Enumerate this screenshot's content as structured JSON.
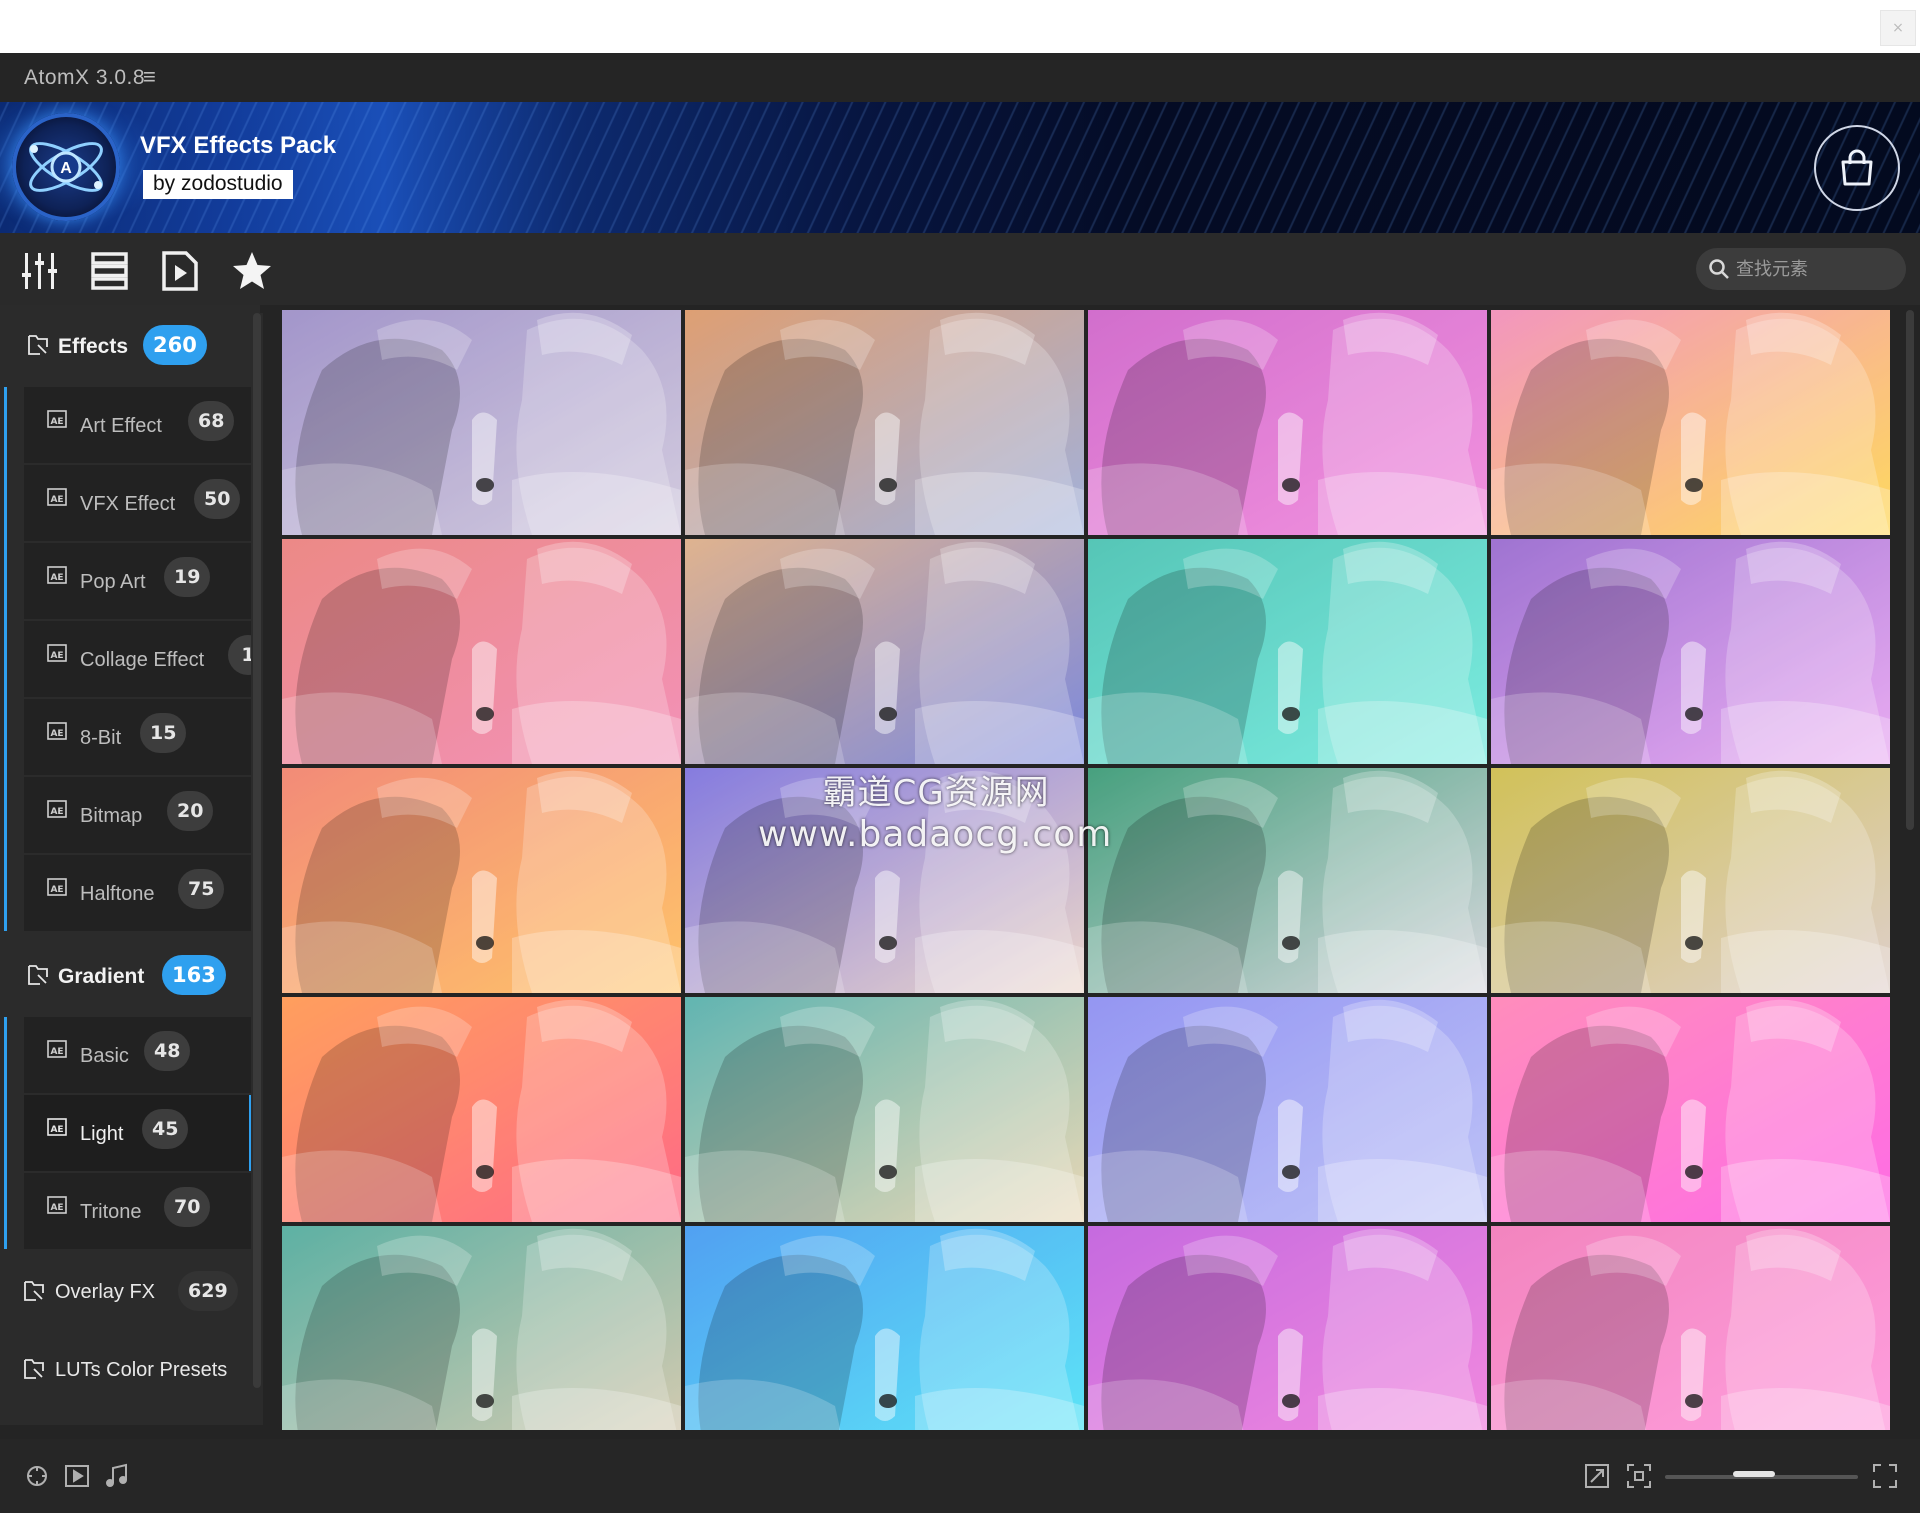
{
  "app": {
    "title": "AtomX 3.0.8",
    "menu_glyph": "≡"
  },
  "banner": {
    "pack_title": "VFX Effects Pack",
    "byline": "by zodostudio"
  },
  "toolbar": {
    "icons": [
      "sliders-icon",
      "list-view-icon",
      "media-file-icon",
      "star-icon"
    ],
    "search_placeholder": "查找元素"
  },
  "sidebar": {
    "categories": [
      {
        "label": "Effects",
        "count": "260",
        "expanded": true,
        "children": [
          {
            "label": "Art Effect",
            "count": "68"
          },
          {
            "label": "VFX Effect",
            "count": "50"
          },
          {
            "label": "Pop Art",
            "count": "19"
          },
          {
            "label": "Collage Effect",
            "count": "1"
          },
          {
            "label": "8-Bit",
            "count": "15"
          },
          {
            "label": "Bitmap",
            "count": "20"
          },
          {
            "label": "Halftone",
            "count": "75"
          }
        ]
      },
      {
        "label": "Gradient",
        "count": "163",
        "expanded": true,
        "children": [
          {
            "label": "Basic",
            "count": "48"
          },
          {
            "label": "Light",
            "count": "45",
            "selected": true
          },
          {
            "label": "Tritone",
            "count": "70"
          }
        ]
      },
      {
        "label": "Overlay FX",
        "count": "629"
      },
      {
        "label": "LUTs Color Presets",
        "count": ""
      }
    ]
  },
  "grid": {
    "columns": 4,
    "tiles": [
      {
        "from": "#8f7fbf",
        "to": "#c9c0d8"
      },
      {
        "from": "#d78a55",
        "to": "#8ea1d4"
      },
      {
        "from": "#c84fc2",
        "to": "#f07ad8"
      },
      {
        "from": "#f07fb0",
        "to": "#ffd23a"
      },
      {
        "from": "#e8706c",
        "to": "#f07aa8"
      },
      {
        "from": "#d8a277",
        "to": "#6070d6"
      },
      {
        "from": "#31b9a7",
        "to": "#5fe8da"
      },
      {
        "from": "#8a55c8",
        "to": "#e59af0"
      },
      {
        "from": "#f0725a",
        "to": "#ffb74a"
      },
      {
        "from": "#6b5fd8",
        "to": "#e7cdbf"
      },
      {
        "from": "#1f8c63",
        "to": "#cfcfd6"
      },
      {
        "from": "#c8b435",
        "to": "#d8c6c0"
      },
      {
        "from": "#ff8a3a",
        "to": "#ff4a6c"
      },
      {
        "from": "#3fa5a0",
        "to": "#e4cfa6"
      },
      {
        "from": "#7d7ff0",
        "to": "#b0b6f5"
      },
      {
        "from": "#ff74ad",
        "to": "#ff4ce0"
      },
      {
        "from": "#3aa090",
        "to": "#cfc0a0"
      },
      {
        "from": "#2b8cf0",
        "to": "#3ae2f5"
      },
      {
        "from": "#b94ad8",
        "to": "#f070d8"
      },
      {
        "from": "#f06ab0",
        "to": "#ff8ad8"
      }
    ]
  },
  "watermark": {
    "line1": "霸道CG资源网",
    "line2": "www.badaocg.com"
  },
  "statusbar": {
    "left_icons": [
      "gamepad-icon",
      "play-box-icon",
      "music-note-icon"
    ],
    "right_icons": [
      "expand-icon",
      "fit-icon",
      "fullscreen-icon"
    ],
    "zoom_level": 0.45
  }
}
